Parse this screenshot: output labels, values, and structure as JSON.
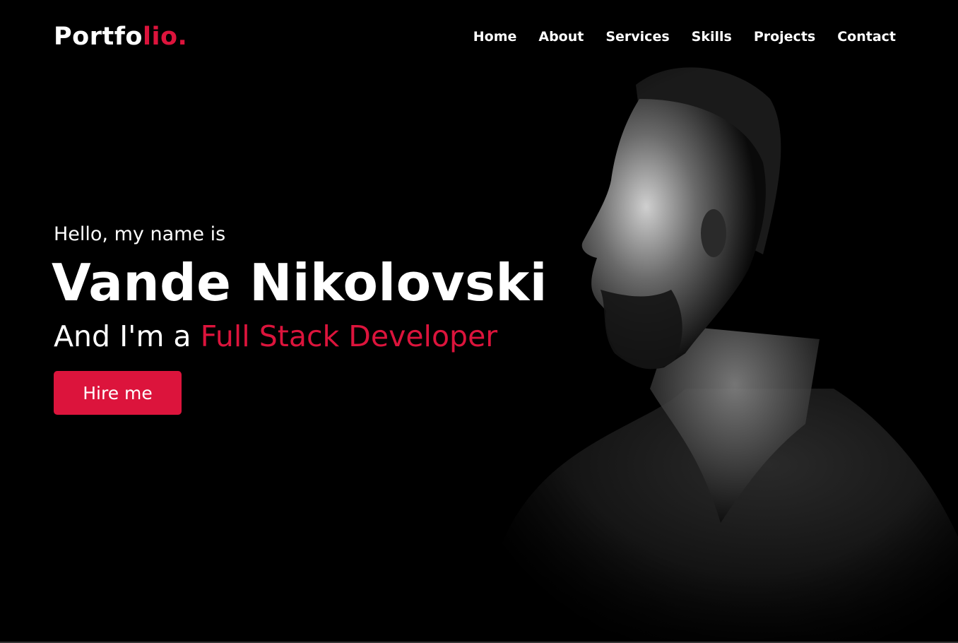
{
  "logo": {
    "text": "Portfo",
    "accent_text": "lio."
  },
  "nav": [
    {
      "label": "Home"
    },
    {
      "label": "About"
    },
    {
      "label": "Services"
    },
    {
      "label": "Skills"
    },
    {
      "label": "Projects"
    },
    {
      "label": "Contact"
    }
  ],
  "hero": {
    "greeting": "Hello, my name is",
    "name": "Vande Nikolovski",
    "role_prefix": "And I'm a ",
    "role_highlight": "Full Stack Developer",
    "cta_label": "Hire me"
  },
  "colors": {
    "accent": "#dc143c",
    "background": "#000000",
    "text": "#ffffff"
  }
}
